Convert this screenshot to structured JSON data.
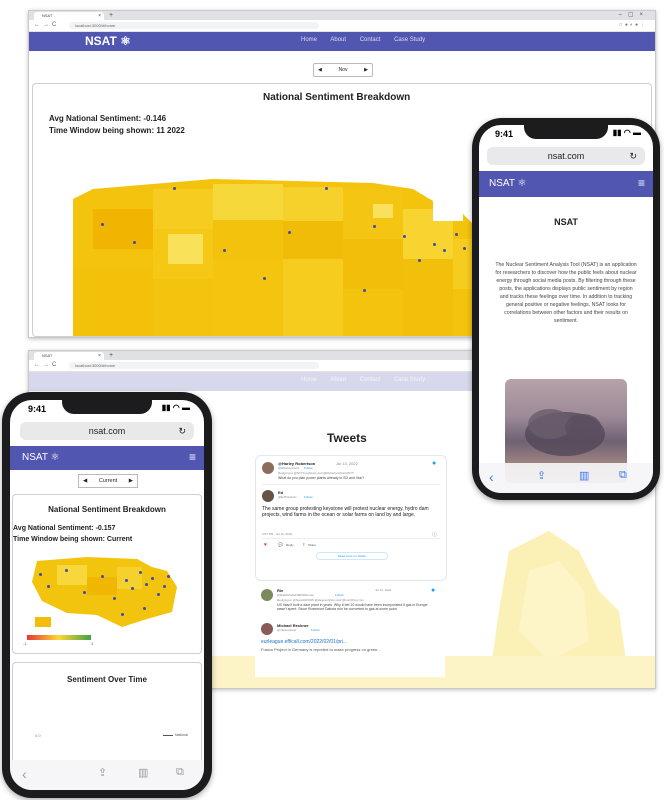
{
  "brand": "NSAT",
  "nav_links": [
    "Home",
    "About",
    "Contact",
    "Case Study"
  ],
  "desktop_top": {
    "tab_title": "NSAT",
    "url": "localhost:3000/#/home",
    "time_selector": "Nov",
    "card_title": "National Sentiment Breakdown",
    "avg_sentiment": "Avg National Sentiment: -0.146",
    "time_window": "Time Window being shown: 11 2022"
  },
  "desktop_bottom": {
    "tab_title": "NSAT",
    "url": "localhost:3000/#/home",
    "tweets_title": "Tweets",
    "tweets": [
      {
        "author": "@Harley Robertson",
        "handle": "@HRobertsonS",
        "follow": "Follow",
        "date": "Jul 13, 2022",
        "reply_to": "Replying to @NYTimesNews and @RobertsonDavidNYT",
        "text": "What do you plan power plants already in SD and Xtar?"
      },
      {
        "author": "Ed",
        "handle": "@EdTradesIn",
        "follow": "Follow",
        "text": "The same group protesting keystone will protest nuclear energy, hydro dam projects, wind farms in the ocean or solar farms on land by and large.",
        "time": "4:57 PM · Jul 13, 2022",
        "reply": "Reply",
        "share": "Share",
        "more": "Read more on Twitter"
      },
      {
        "author": "Rie",
        "handle": "@RieMichelleNMNSRunner",
        "follow": "Follow",
        "date": "Jul 14, 2022",
        "reply_to": "Replying to @SocaOkNOW @HeavenlyNov and @ListOfGuy Gu",
        "text": "US hasn't built a dam plant in years. Why it bet 10 would have been incorporated if gas in Europe wasn't spent. Since Rosemont Dakota ruin be converted to gas at some point."
      },
      {
        "author": "Michael Reckner",
        "handle": "@mikereckner",
        "follow": "Follow",
        "link": "eurleague.efficall.com/2022/02/01/pri...",
        "text": "Fusion Project in Germany is reported to make progress on green..."
      }
    ]
  },
  "phone_right": {
    "time": "9:41",
    "url": "nsat.com",
    "heading": "NSAT",
    "paragraph": "The Nuclear Sentiment Analysis Tool (NSAT) is an application for researchers to discover how the public feels about nuclear energy through social media posts. By filtering through these posts, the applications displays public sentiment by region and tracks these feelings over time. In addition to tracking general positive or negative feelings, NSAT looks for correlations between other factors and their results on sentiment."
  },
  "phone_left": {
    "time": "9:41",
    "url": "nsat.com",
    "time_selector": "Current",
    "card_title": "National Sentiment Breakdown",
    "avg_sentiment": "Avg National Sentiment: -0.157",
    "time_window": "Time Window being shown: Current",
    "legend_min": "-1",
    "legend_max": "1",
    "second_title": "Sentiment Over Time",
    "axis_tick": "0.0",
    "legend_line": "National"
  },
  "colors": {
    "navbar": "#5156b1",
    "map_high": "#f0b500",
    "map_low": "#fff176",
    "dot": "#3b4bb6",
    "ios_blue": "#3478f6"
  }
}
